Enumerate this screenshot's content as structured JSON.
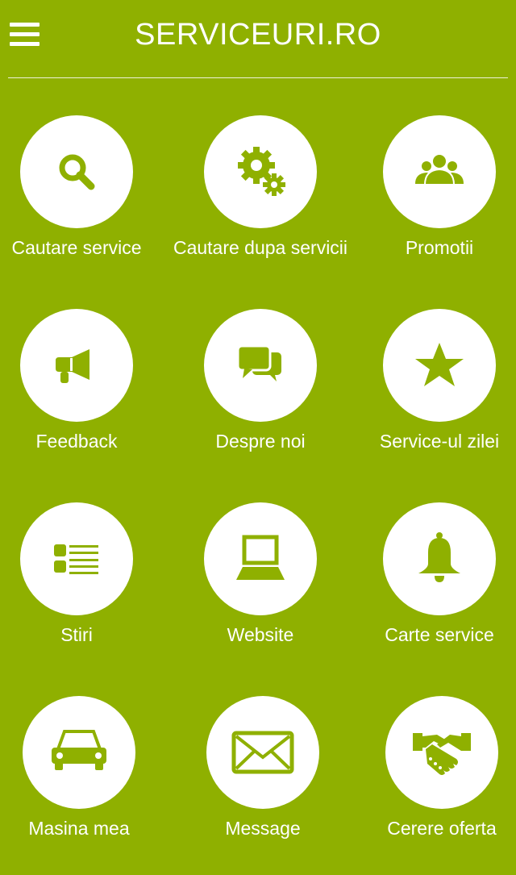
{
  "app": {
    "title": "SERVICEURI.RO",
    "accent_color": "#8fb000",
    "icon_color": "#8fb000",
    "tile_color": "#ffffff"
  },
  "header": {
    "menu_icon": "hamburger-menu-icon"
  },
  "tiles": [
    {
      "label": "Cautare service",
      "icon": "search-icon"
    },
    {
      "label": "Cautare dupa servicii",
      "icon": "gears-icon"
    },
    {
      "label": "Promotii",
      "icon": "group-icon"
    },
    {
      "label": "Feedback",
      "icon": "megaphone-icon"
    },
    {
      "label": "Despre noi",
      "icon": "chat-bubbles-icon"
    },
    {
      "label": "Service-ul zilei",
      "icon": "star-icon"
    },
    {
      "label": "Stiri",
      "icon": "list-icon"
    },
    {
      "label": "Website",
      "icon": "laptop-icon"
    },
    {
      "label": "Carte service",
      "icon": "bell-icon"
    },
    {
      "label": "Masina mea",
      "icon": "car-icon"
    },
    {
      "label": "Message",
      "icon": "envelope-icon"
    },
    {
      "label": "Cerere oferta",
      "icon": "handshake-icon"
    }
  ]
}
